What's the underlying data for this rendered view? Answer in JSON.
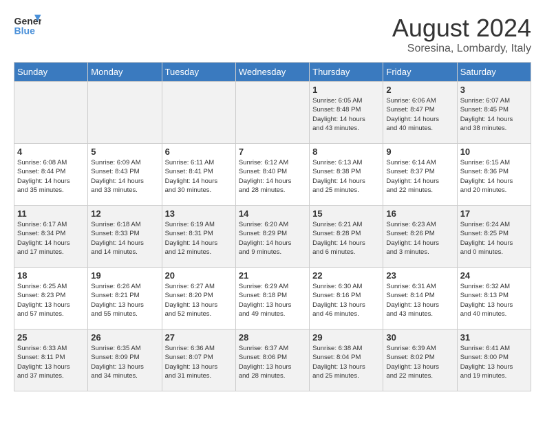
{
  "header": {
    "logo_line1": "General",
    "logo_line2": "Blue",
    "title": "August 2024",
    "subtitle": "Soresina, Lombardy, Italy"
  },
  "weekdays": [
    "Sunday",
    "Monday",
    "Tuesday",
    "Wednesday",
    "Thursday",
    "Friday",
    "Saturday"
  ],
  "weeks": [
    [
      {
        "day": "",
        "info": ""
      },
      {
        "day": "",
        "info": ""
      },
      {
        "day": "",
        "info": ""
      },
      {
        "day": "",
        "info": ""
      },
      {
        "day": "1",
        "info": "Sunrise: 6:05 AM\nSunset: 8:48 PM\nDaylight: 14 hours\nand 43 minutes."
      },
      {
        "day": "2",
        "info": "Sunrise: 6:06 AM\nSunset: 8:47 PM\nDaylight: 14 hours\nand 40 minutes."
      },
      {
        "day": "3",
        "info": "Sunrise: 6:07 AM\nSunset: 8:45 PM\nDaylight: 14 hours\nand 38 minutes."
      }
    ],
    [
      {
        "day": "4",
        "info": "Sunrise: 6:08 AM\nSunset: 8:44 PM\nDaylight: 14 hours\nand 35 minutes."
      },
      {
        "day": "5",
        "info": "Sunrise: 6:09 AM\nSunset: 8:43 PM\nDaylight: 14 hours\nand 33 minutes."
      },
      {
        "day": "6",
        "info": "Sunrise: 6:11 AM\nSunset: 8:41 PM\nDaylight: 14 hours\nand 30 minutes."
      },
      {
        "day": "7",
        "info": "Sunrise: 6:12 AM\nSunset: 8:40 PM\nDaylight: 14 hours\nand 28 minutes."
      },
      {
        "day": "8",
        "info": "Sunrise: 6:13 AM\nSunset: 8:38 PM\nDaylight: 14 hours\nand 25 minutes."
      },
      {
        "day": "9",
        "info": "Sunrise: 6:14 AM\nSunset: 8:37 PM\nDaylight: 14 hours\nand 22 minutes."
      },
      {
        "day": "10",
        "info": "Sunrise: 6:15 AM\nSunset: 8:36 PM\nDaylight: 14 hours\nand 20 minutes."
      }
    ],
    [
      {
        "day": "11",
        "info": "Sunrise: 6:17 AM\nSunset: 8:34 PM\nDaylight: 14 hours\nand 17 minutes."
      },
      {
        "day": "12",
        "info": "Sunrise: 6:18 AM\nSunset: 8:33 PM\nDaylight: 14 hours\nand 14 minutes."
      },
      {
        "day": "13",
        "info": "Sunrise: 6:19 AM\nSunset: 8:31 PM\nDaylight: 14 hours\nand 12 minutes."
      },
      {
        "day": "14",
        "info": "Sunrise: 6:20 AM\nSunset: 8:29 PM\nDaylight: 14 hours\nand 9 minutes."
      },
      {
        "day": "15",
        "info": "Sunrise: 6:21 AM\nSunset: 8:28 PM\nDaylight: 14 hours\nand 6 minutes."
      },
      {
        "day": "16",
        "info": "Sunrise: 6:23 AM\nSunset: 8:26 PM\nDaylight: 14 hours\nand 3 minutes."
      },
      {
        "day": "17",
        "info": "Sunrise: 6:24 AM\nSunset: 8:25 PM\nDaylight: 14 hours\nand 0 minutes."
      }
    ],
    [
      {
        "day": "18",
        "info": "Sunrise: 6:25 AM\nSunset: 8:23 PM\nDaylight: 13 hours\nand 57 minutes."
      },
      {
        "day": "19",
        "info": "Sunrise: 6:26 AM\nSunset: 8:21 PM\nDaylight: 13 hours\nand 55 minutes."
      },
      {
        "day": "20",
        "info": "Sunrise: 6:27 AM\nSunset: 8:20 PM\nDaylight: 13 hours\nand 52 minutes."
      },
      {
        "day": "21",
        "info": "Sunrise: 6:29 AM\nSunset: 8:18 PM\nDaylight: 13 hours\nand 49 minutes."
      },
      {
        "day": "22",
        "info": "Sunrise: 6:30 AM\nSunset: 8:16 PM\nDaylight: 13 hours\nand 46 minutes."
      },
      {
        "day": "23",
        "info": "Sunrise: 6:31 AM\nSunset: 8:14 PM\nDaylight: 13 hours\nand 43 minutes."
      },
      {
        "day": "24",
        "info": "Sunrise: 6:32 AM\nSunset: 8:13 PM\nDaylight: 13 hours\nand 40 minutes."
      }
    ],
    [
      {
        "day": "25",
        "info": "Sunrise: 6:33 AM\nSunset: 8:11 PM\nDaylight: 13 hours\nand 37 minutes."
      },
      {
        "day": "26",
        "info": "Sunrise: 6:35 AM\nSunset: 8:09 PM\nDaylight: 13 hours\nand 34 minutes."
      },
      {
        "day": "27",
        "info": "Sunrise: 6:36 AM\nSunset: 8:07 PM\nDaylight: 13 hours\nand 31 minutes."
      },
      {
        "day": "28",
        "info": "Sunrise: 6:37 AM\nSunset: 8:06 PM\nDaylight: 13 hours\nand 28 minutes."
      },
      {
        "day": "29",
        "info": "Sunrise: 6:38 AM\nSunset: 8:04 PM\nDaylight: 13 hours\nand 25 minutes."
      },
      {
        "day": "30",
        "info": "Sunrise: 6:39 AM\nSunset: 8:02 PM\nDaylight: 13 hours\nand 22 minutes."
      },
      {
        "day": "31",
        "info": "Sunrise: 6:41 AM\nSunset: 8:00 PM\nDaylight: 13 hours\nand 19 minutes."
      }
    ]
  ]
}
